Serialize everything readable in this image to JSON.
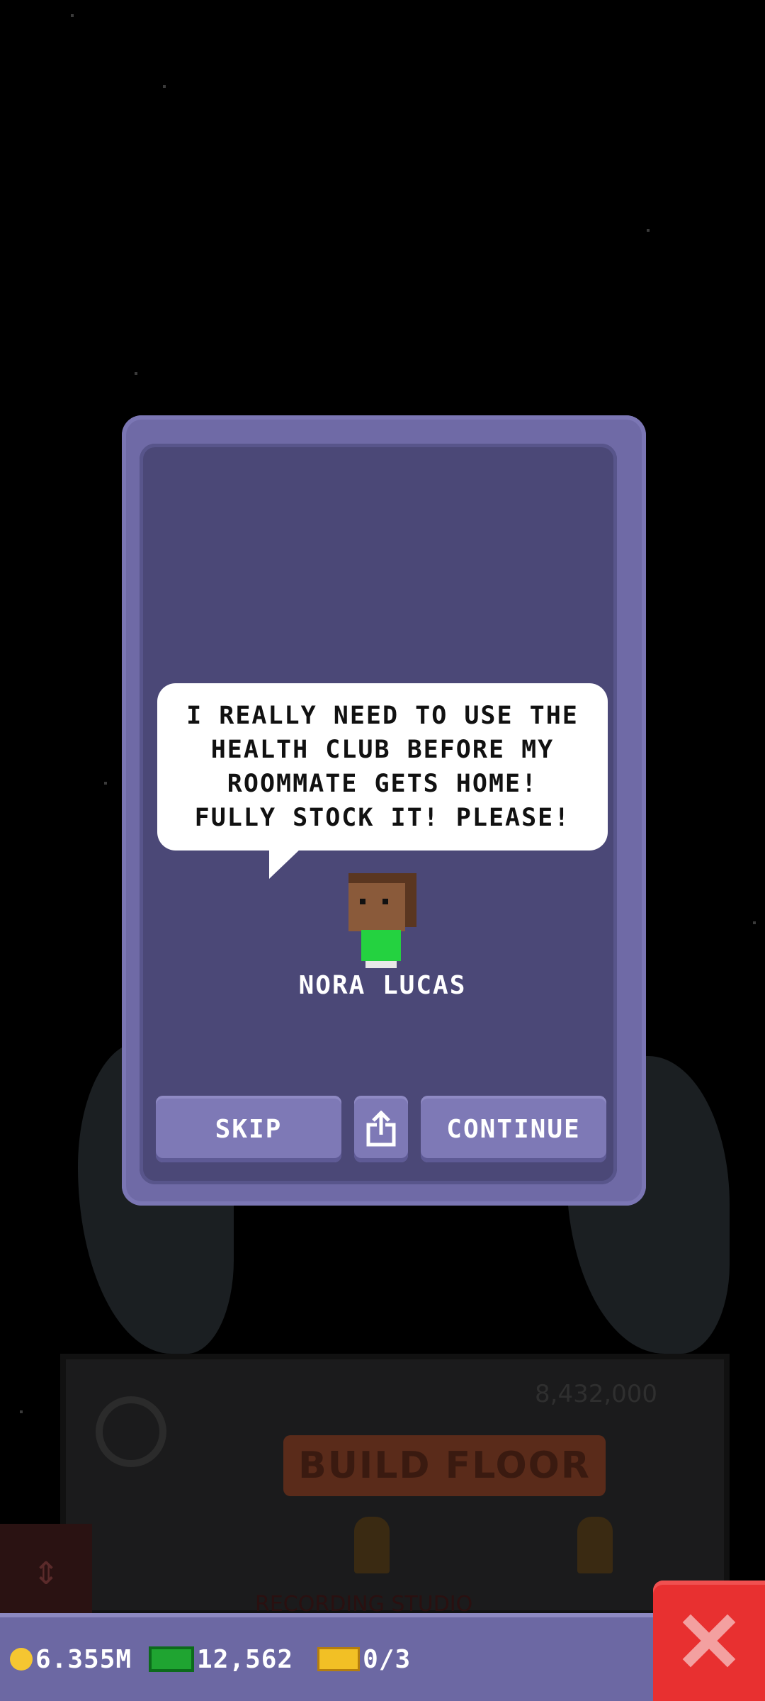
{
  "dialog": {
    "speech_text_lines": [
      "I REALLY NEED TO USE THE",
      "HEALTH CLUB BEFORE MY",
      "ROOMMATE GETS HOME!",
      "FULLY STOCK IT! PLEASE!"
    ],
    "character_name": "NORA LUCAS",
    "skip_label": "SKIP",
    "continue_label": "CONTINUE",
    "share_icon": "share-icon"
  },
  "background": {
    "floor_cost": "8,432,000",
    "build_floor_label": "BUILD FLOOR",
    "floor_name": "RECORDING STUDIO"
  },
  "status_bar": {
    "coins": "6.355M",
    "bux": "12,562",
    "tickets": "0/3"
  },
  "colors": {
    "dialog_frame": "#6f6aa6",
    "dialog_body": "#4b4877",
    "button": "#7e79b6",
    "close_button": "#e83030",
    "coin": "#f5c631",
    "bux": "#1fa431"
  }
}
